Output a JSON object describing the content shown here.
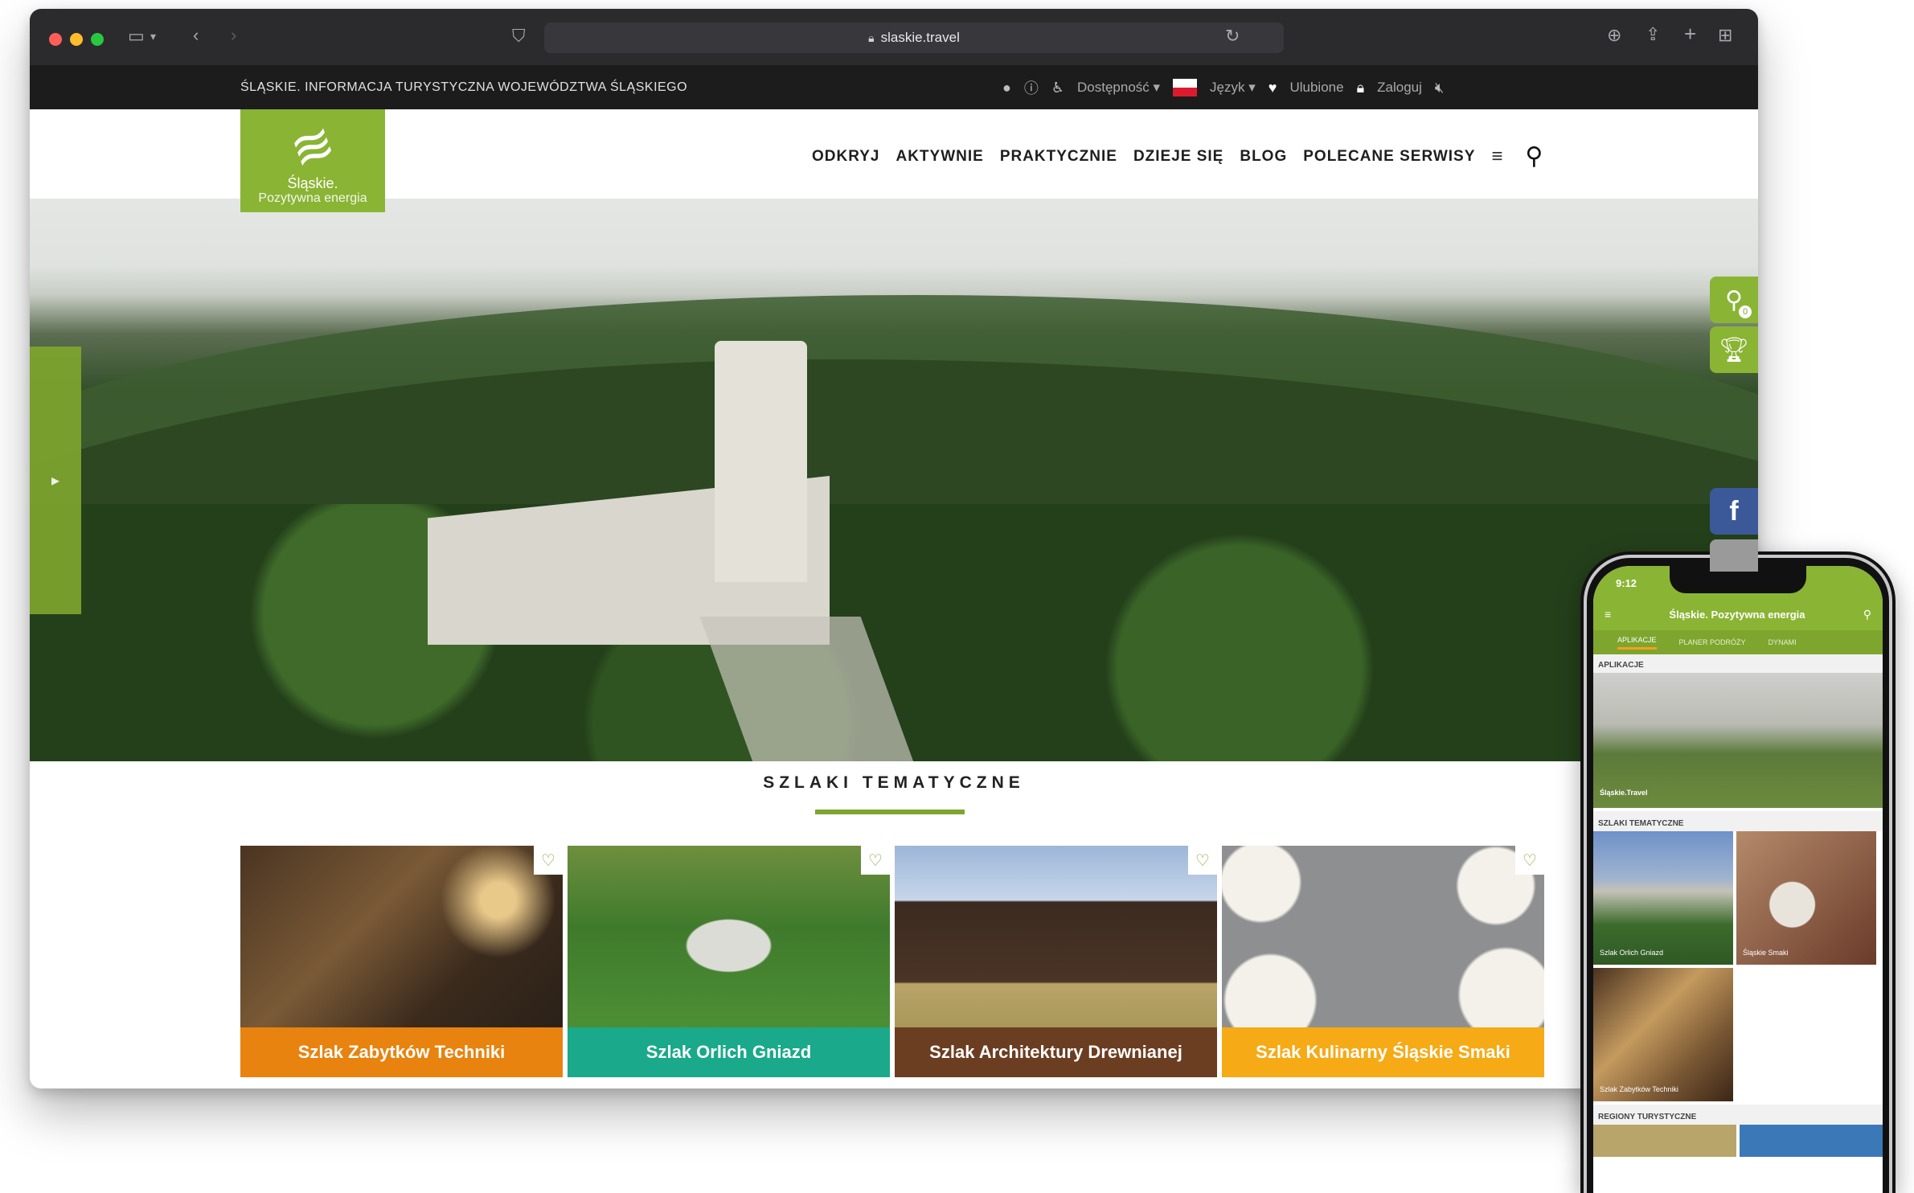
{
  "browser": {
    "url": "slaskie.travel"
  },
  "topbar": {
    "site_info": "ŚLĄSKIE. INFORMACJA TURYSTYCZNA WOJEWÓDZTWA ŚLĄSKIEGO",
    "accessibility": "Dostępność ▾",
    "language": "Język ▾",
    "favorites": "Ulubione",
    "login": "Zaloguj"
  },
  "logo": {
    "brand": "Śląskie.",
    "tagline": "Pozytywna energia"
  },
  "nav": {
    "items": [
      "ODKRYJ",
      "AKTYWNIE",
      "PRAKTYCZNIE",
      "DZIEJE SIĘ",
      "BLOG",
      "POLECANE SERWISY"
    ]
  },
  "side": {
    "badge": "0"
  },
  "section": {
    "title": "SZLAKI TEMATYCZNE"
  },
  "cards": [
    {
      "label": "Szlak Zabytków Techniki",
      "color": "#e8830f"
    },
    {
      "label": "Szlak Orlich Gniazd",
      "color": "#1aa98a"
    },
    {
      "label": "Szlak Architektury Drewnianej",
      "color": "#6b3e22"
    },
    {
      "label": "Szlak Kulinarny Śląskie Smaki",
      "color": "#f6aa16"
    }
  ],
  "phone": {
    "time": "9:12",
    "brand": "Śląskie. Pozytywna energia",
    "tabs": [
      "APLIKACJE",
      "PLANER PODRÓŻY",
      "DYNAMI"
    ],
    "section_apps": "APLIKACJE",
    "app_caption": "Śląskie.Travel",
    "section_trails": "SZLAKI TEMATYCZNE",
    "tiles": [
      "Szlak Orlich Gniazd",
      "Śląskie Smaki",
      "Szlak Zabytków Techniki"
    ],
    "section_regions": "REGIONY TURYSTYCZNE"
  }
}
